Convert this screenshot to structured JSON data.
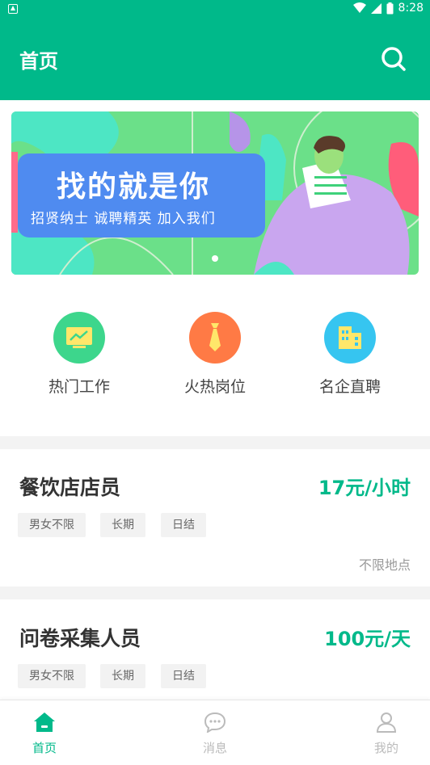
{
  "status_bar": {
    "time": "8:28"
  },
  "header": {
    "title": "首页"
  },
  "banner": {
    "headline": "找的就是你",
    "subline": "招贤纳士 诚聘精英 加入我们"
  },
  "quick_entries": [
    {
      "label": "热门工作",
      "icon": "chart-icon",
      "color": "#3dd68c"
    },
    {
      "label": "火热岗位",
      "icon": "tie-icon",
      "color": "#ff7a45"
    },
    {
      "label": "名企直聘",
      "icon": "building-icon",
      "color": "#36c5f0"
    }
  ],
  "jobs": [
    {
      "title": "餐饮店店员",
      "salary": "17元/小时",
      "tags": [
        "男女不限",
        "长期",
        "日结"
      ],
      "location": "不限地点"
    },
    {
      "title": "问卷采集人员",
      "salary": "100元/天",
      "tags": [
        "男女不限",
        "长期",
        "日结"
      ]
    }
  ],
  "tab_bar": {
    "tabs": [
      {
        "label": "首页",
        "icon": "home-icon",
        "active": true
      },
      {
        "label": "消息",
        "icon": "message-icon",
        "active": false
      },
      {
        "label": "我的",
        "icon": "user-icon",
        "active": false
      }
    ]
  },
  "colors": {
    "primary": "#00b98a",
    "inactive": "#bbbbbb"
  }
}
